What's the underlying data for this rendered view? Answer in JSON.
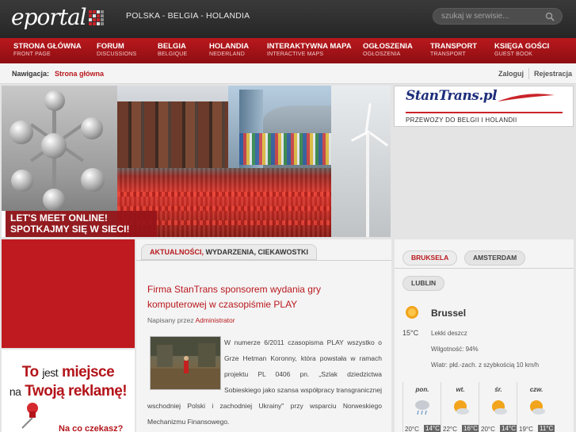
{
  "header": {
    "logo_text": "eportal",
    "tagline": "POLSKA - BELGIA - HOLANDIA",
    "search_placeholder": "szukaj w serwisie..."
  },
  "nav": [
    {
      "main": "STRONA GŁÓWNA",
      "sub": "FRONT PAGE"
    },
    {
      "main": "FORUM",
      "sub": "DISCUSSIONS"
    },
    {
      "main": "BELGIA",
      "sub": "BELGIQUE"
    },
    {
      "main": "HOLANDIA",
      "sub": "NEDERLAND"
    },
    {
      "main": "INTERAKTYWNA MAPA",
      "sub": "INTERACTIVE MAPS"
    },
    {
      "main": "OGŁOSZENIA",
      "sub": "OGŁOSZENIA"
    },
    {
      "main": "TRANSPORT",
      "sub": "TRANSPORT"
    },
    {
      "main": "KSIĘGA GOŚCI",
      "sub": "GUEST BOOK"
    }
  ],
  "breadcrumb": {
    "label": "Nawigacja:",
    "current": "Strona główna"
  },
  "auth": {
    "login": "Zaloguj",
    "register": "Rejestracja"
  },
  "banner": {
    "line1": "LET'S MEET ONLINE!",
    "line2": "SPOTKAJMY SIĘ W SIECI!"
  },
  "stantrans": {
    "logo": "StanTrans.pl",
    "tagline": "PRZEWOZY DO BELGII I HOLANDII"
  },
  "ad": {
    "to": "To",
    "jest": "jest",
    "miejsce": "miejsce",
    "na": "na",
    "twoja": "Twoją",
    "reklame": "reklamę!",
    "cta": "Na co czekasz?"
  },
  "news": {
    "tab_highlight": "AKTUALNOŚCI,",
    "tab_rest": " WYDARZENIA, CIEKAWOSTKI",
    "title": "Firma StanTrans sponsorem wydania gry komputerowej w czasopiśmie PLAY",
    "meta_prefix": "Napisany przez ",
    "author": "Administrator",
    "body": "W numerze 6/2011 czasopisma PLAY wszystko o Grze Hetman Koronny, która powstała w ramach projektu PL 0406 pn. „Szlak dziedzictwa Sobieskiego jako szansa współpracy transgranicznej wschodniej Polski i zachodniej Ukrainy\" przy wsparciu Norweskiego Mechanizmu Finansowego."
  },
  "weather": {
    "tabs": [
      "BRUKSELA",
      "AMSTERDAM",
      "LUBLIN"
    ],
    "active_tab": "BRUKSELA",
    "city": "Brussel",
    "temp": "15°C",
    "desc": "Lekki deszcz",
    "humidity": "Wilgotność: 94%",
    "wind": "Wiatr: płd.-zach. z szybkością 10 km/h",
    "forecast": [
      {
        "day": "pon.",
        "hi": "20°C",
        "lo": "14°C",
        "icon": "rain-icon"
      },
      {
        "day": "wt.",
        "hi": "22°C",
        "lo": "16°C",
        "icon": "partly-sunny-icon"
      },
      {
        "day": "śr.",
        "hi": "20°C",
        "lo": "14°C",
        "icon": "partly-sunny-icon"
      },
      {
        "day": "czw.",
        "hi": "19°C",
        "lo": "11°C",
        "icon": "partly-sunny-icon"
      }
    ]
  },
  "colors": {
    "brand_red": "#b9181d",
    "header_dark": "#2e2e2e",
    "panel": "#f4f4f4"
  }
}
